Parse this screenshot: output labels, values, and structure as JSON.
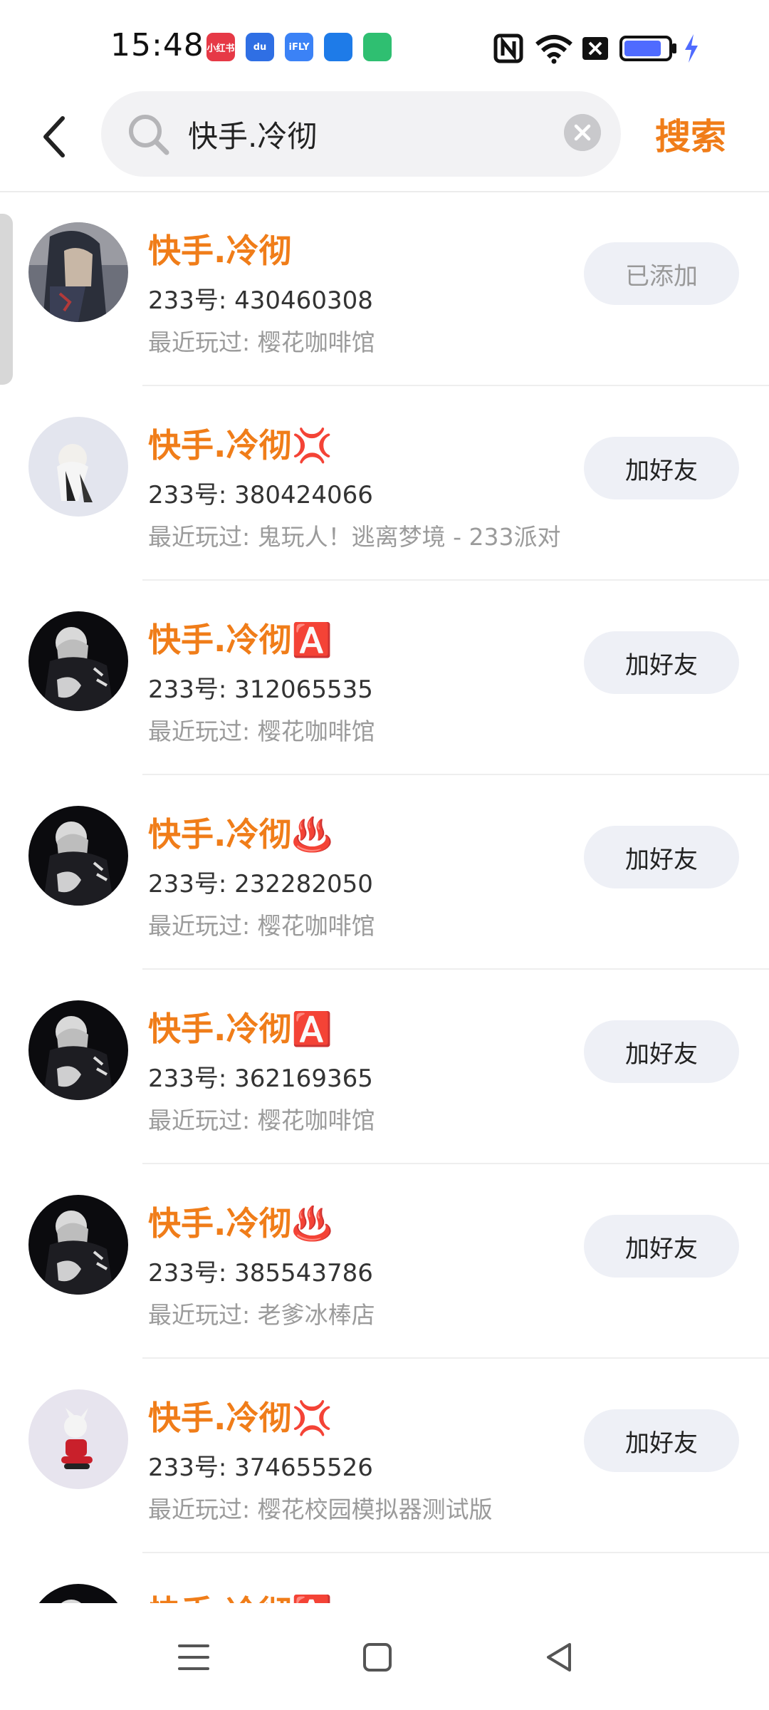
{
  "status_bar": {
    "time": "15:48",
    "app_icons": [
      {
        "name": "xiaohongshu-icon",
        "label": "小红书",
        "color": "#e63946"
      },
      {
        "name": "baidu-icon",
        "label": "du",
        "color": "#2f6fe4"
      },
      {
        "name": "ifly-icon",
        "label": "iFLY",
        "color": "#3b82f6"
      },
      {
        "name": "shield-app-icon",
        "label": "",
        "color": "#1e7be8"
      },
      {
        "name": "battery-app-icon",
        "label": "",
        "color": "#2fbf71"
      }
    ],
    "right_icons": [
      "nfc-icon",
      "wifi-icon",
      "no-sim-icon",
      "battery-icon",
      "charging-icon"
    ],
    "battery_level": 0.85
  },
  "header": {
    "search_value": "快手.冷彻",
    "search_button_label": "搜索"
  },
  "colors": {
    "accent": "#f07d19",
    "button_bg": "#eef0f6",
    "battery": "#4f6bff"
  },
  "results": [
    {
      "name": "快手.冷彻",
      "emoji": "",
      "id_line": "233号: 430460308",
      "played": "最近玩过: 樱花咖啡馆",
      "action": "已添加",
      "added": true,
      "avatar": "dark-photo"
    },
    {
      "name": "快手.冷彻",
      "emoji": "💢",
      "id_line": "233号: 380424066",
      "played": "最近玩过: 鬼玩人！逃离梦境 - 233派对",
      "action": "加好友",
      "added": false,
      "avatar": "light-figure"
    },
    {
      "name": "快手.冷彻",
      "emoji": "🅰️",
      "id_line": "233号: 312065535",
      "played": "最近玩过: 樱花咖啡馆",
      "action": "加好友",
      "added": false,
      "avatar": "dark-character"
    },
    {
      "name": "快手.冷彻",
      "emoji": "♨️",
      "id_line": "233号: 232282050",
      "played": "最近玩过: 樱花咖啡馆",
      "action": "加好友",
      "added": false,
      "avatar": "dark-character"
    },
    {
      "name": "快手.冷彻",
      "emoji": "🅰️",
      "id_line": "233号: 362169365",
      "played": "最近玩过: 樱花咖啡馆",
      "action": "加好友",
      "added": false,
      "avatar": "dark-character"
    },
    {
      "name": "快手.冷彻",
      "emoji": "♨️",
      "id_line": "233号: 385543786",
      "played": "最近玩过: 老爹冰棒店",
      "action": "加好友",
      "added": false,
      "avatar": "dark-character"
    },
    {
      "name": "快手.冷彻",
      "emoji": "💢",
      "id_line": "233号: 374655526",
      "played": "最近玩过: 樱花校园模拟器测试版",
      "action": "加好友",
      "added": false,
      "avatar": "red-figure"
    },
    {
      "name": "快手.冷彻",
      "emoji": "🅰️",
      "id_line": "",
      "played": "",
      "action": "",
      "added": false,
      "avatar": "dark-character"
    }
  ],
  "nav_bar": {
    "items": [
      "menu-icon",
      "home-square-icon",
      "back-triangle-icon"
    ]
  }
}
